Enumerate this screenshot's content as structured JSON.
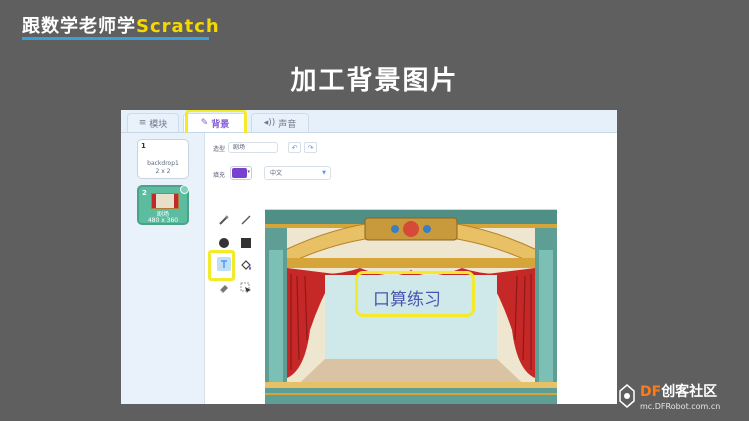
{
  "brand": {
    "prefix": "跟数学老师学",
    "suffix": "Scratch"
  },
  "slide_title": "加工背景图片",
  "editor": {
    "tabs": [
      {
        "icon": "code-icon",
        "label": "模块"
      },
      {
        "icon": "brush-icon",
        "label": "背景"
      },
      {
        "icon": "speaker-icon",
        "label": "声音"
      }
    ],
    "backdrops": [
      {
        "number": "1",
        "name": "backdrop1",
        "size": "2 x 2"
      },
      {
        "number": "2",
        "name": "剧场",
        "size": "480 x 360"
      }
    ],
    "paint": {
      "name_label": "造型",
      "name_value": "剧场",
      "fill_label": "填充",
      "fill_color": "#7a40d1",
      "mode_value": "中文",
      "tools": [
        "brush-icon",
        "line-icon",
        "circle-icon",
        "rectangle-icon",
        "text-icon",
        "fill-icon",
        "eraser-icon",
        "select-icon"
      ]
    },
    "stage_label": "口算练习"
  },
  "footer": {
    "logo_df": "DF",
    "logo_rest": "创客社区",
    "url": "mc.DFRobot.com.cn"
  },
  "colors": {
    "highlight": "#f4ea2c",
    "accent": "#855cd6",
    "background": "#5f5f5f"
  }
}
